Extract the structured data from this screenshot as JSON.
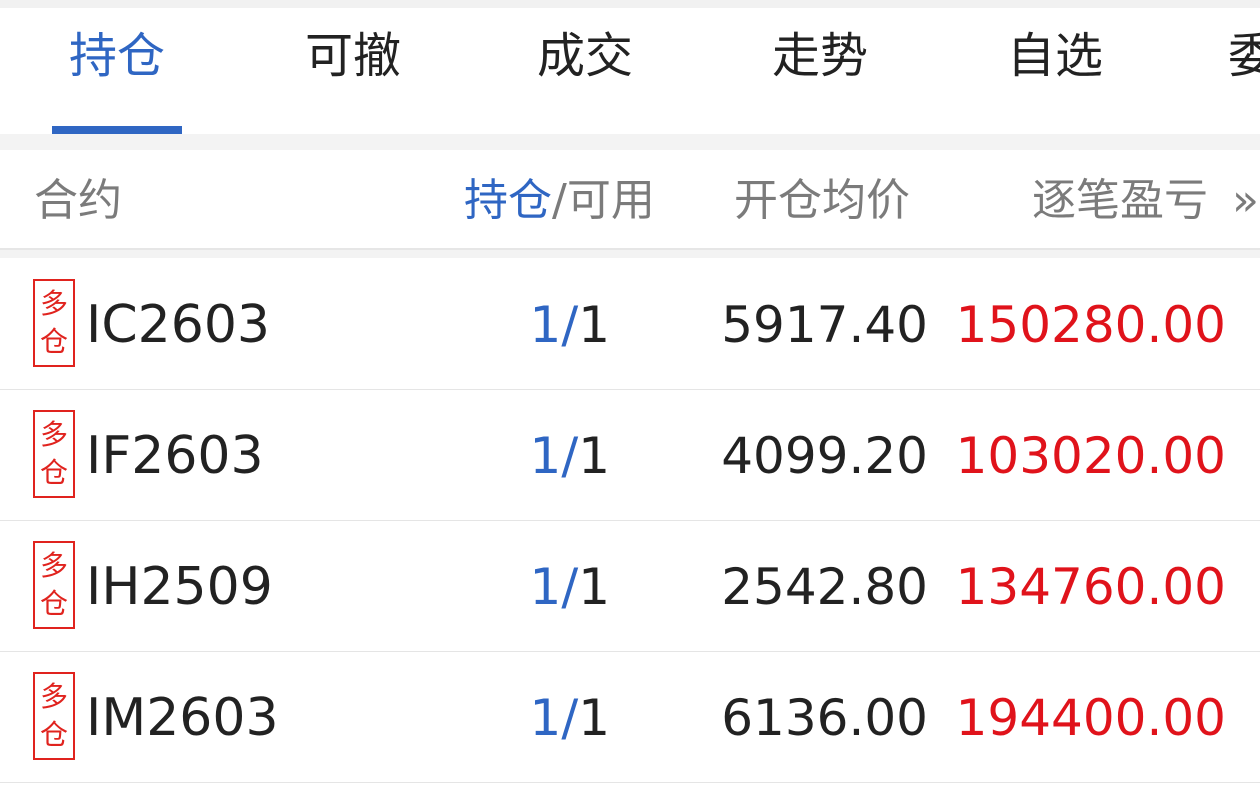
{
  "tabs": [
    {
      "label": "持仓",
      "active": true
    },
    {
      "label": "可撤"
    },
    {
      "label": "成交"
    },
    {
      "label": "走势"
    },
    {
      "label": "自选"
    },
    {
      "label": "委"
    }
  ],
  "columns": {
    "contract": "合约",
    "held": "持仓",
    "separator": "/",
    "available": "可用",
    "avg_price": "开仓均价",
    "pnl": "逐笔盈亏",
    "more_glyph": "»"
  },
  "colors": {
    "accent": "#2f66c3",
    "profit": "#e0131b"
  },
  "positions": [
    {
      "direction_top": "多",
      "direction_bottom": "仓",
      "code": "IC2603",
      "held": "1",
      "sep": "/",
      "available": "1",
      "avg_price": "5917.40",
      "pnl": "150280.00"
    },
    {
      "direction_top": "多",
      "direction_bottom": "仓",
      "code": "IF2603",
      "held": "1",
      "sep": "/",
      "available": "1",
      "avg_price": "4099.20",
      "pnl": "103020.00"
    },
    {
      "direction_top": "多",
      "direction_bottom": "仓",
      "code": "IH2509",
      "held": "1",
      "sep": "/",
      "available": "1",
      "avg_price": "2542.80",
      "pnl": "134760.00"
    },
    {
      "direction_top": "多",
      "direction_bottom": "仓",
      "code": "IM2603",
      "held": "1",
      "sep": "/",
      "available": "1",
      "avg_price": "6136.00",
      "pnl": "194400.00"
    }
  ]
}
